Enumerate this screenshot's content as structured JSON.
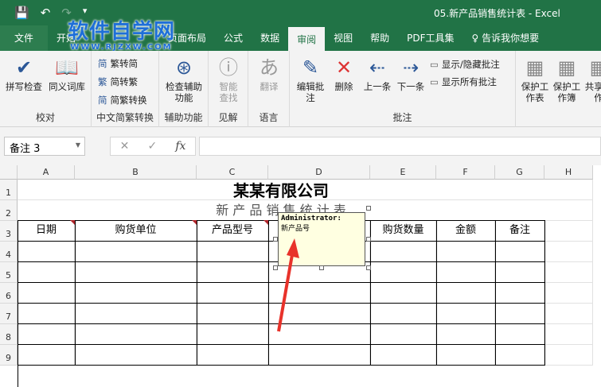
{
  "titlebar": {
    "title": "05.新产品销售统计表  -  Excel",
    "save_icon": "💾",
    "undo_icon": "↶",
    "redo_icon": "↷",
    "customize_icon": "▾"
  },
  "watermark": {
    "text": "软件自学网",
    "url": "WWW.RJZXW.COM"
  },
  "tabs": [
    "文件",
    "开始",
    "插入",
    "页面布局",
    "公式",
    "数据",
    "审阅",
    "视图",
    "帮助",
    "PDF工具集",
    "告诉我你想要"
  ],
  "ribbon": {
    "proofing": {
      "label": "校对",
      "spell": "拼写检查",
      "thesaurus": "同义词库"
    },
    "chinese": {
      "label": "中文简繁转换",
      "t2s": "繁转简",
      "s2t": "简转繁",
      "convert": "简繁转换"
    },
    "access": {
      "label": "辅助功能",
      "check": "检查辅助功能"
    },
    "insights": {
      "label": "见解",
      "smart": "智能查找"
    },
    "language": {
      "label": "语言",
      "translate": "翻译"
    },
    "comments": {
      "label": "批注",
      "edit": "编辑批注",
      "delete": "删除",
      "prev": "上一条",
      "next": "下一条",
      "showhide": "显示/隐藏批注",
      "showall": "显示所有批注"
    },
    "protect": {
      "sheet": "保护工作表",
      "book": "保护工作簿",
      "share": "共享工作"
    }
  },
  "formula": {
    "namebox": "备注 3",
    "cancel": "✕",
    "enter": "✓",
    "fx": "fx",
    "value": ""
  },
  "columns": [
    "A",
    "B",
    "C",
    "D",
    "E",
    "F",
    "G",
    "H"
  ],
  "rows": [
    "1",
    "2",
    "3",
    "4",
    "5",
    "6",
    "7",
    "8",
    "9"
  ],
  "sheet": {
    "title": "某某有限公司",
    "subtitle": "新 产 品 销 售 统 计 表",
    "headers": [
      "日期",
      "购货单位",
      "产品型号",
      "",
      "购货数量",
      "金额",
      "备注"
    ]
  },
  "comment": {
    "author": "Administrator:",
    "text": "新产品号"
  }
}
